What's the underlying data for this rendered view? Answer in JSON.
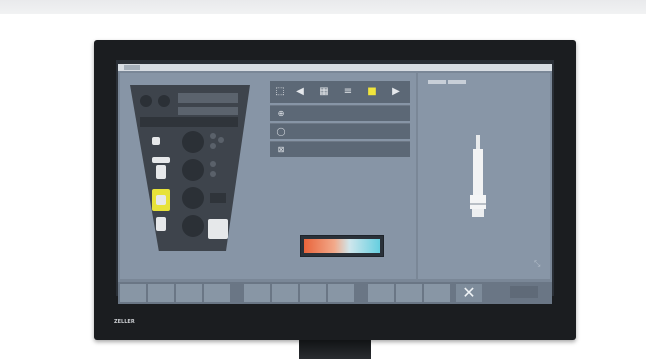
{
  "brand": {
    "logo_text": "ZELLER"
  },
  "screen": {
    "topbar": {
      "tabs": [
        "",
        ""
      ]
    },
    "right_tabs": [
      "",
      ""
    ],
    "toolbar": {
      "icons": [
        {
          "name": "tool-select-icon",
          "glyph": "⬚",
          "active": false
        },
        {
          "name": "arrow-left-icon",
          "glyph": "◀",
          "active": false
        },
        {
          "name": "layers-icon",
          "glyph": "▦",
          "active": false
        },
        {
          "name": "list-icon",
          "glyph": "≡",
          "active": false
        },
        {
          "name": "highlight-icon",
          "glyph": "■",
          "active": true
        },
        {
          "name": "arrow-right-icon",
          "glyph": "▶",
          "active": false
        }
      ]
    },
    "menu_items": [
      {
        "icon": "⊕",
        "icon_name": "add-icon",
        "label": ""
      },
      {
        "icon": "◯",
        "icon_name": "circle-icon",
        "label": ""
      },
      {
        "icon": "⊠",
        "icon_name": "grid-icon",
        "label": ""
      }
    ],
    "gradient": {
      "start": "#e9643b",
      "end": "#66cfe0"
    },
    "bottom_keys": 12,
    "confirm_label": "",
    "status_texts": [
      "",
      "",
      ""
    ],
    "corner_icon": "⤡"
  },
  "colors": {
    "accent_yellow": "#e7e23a",
    "screen_bg": "#7a8797",
    "panel_dark": "#3e444c"
  }
}
